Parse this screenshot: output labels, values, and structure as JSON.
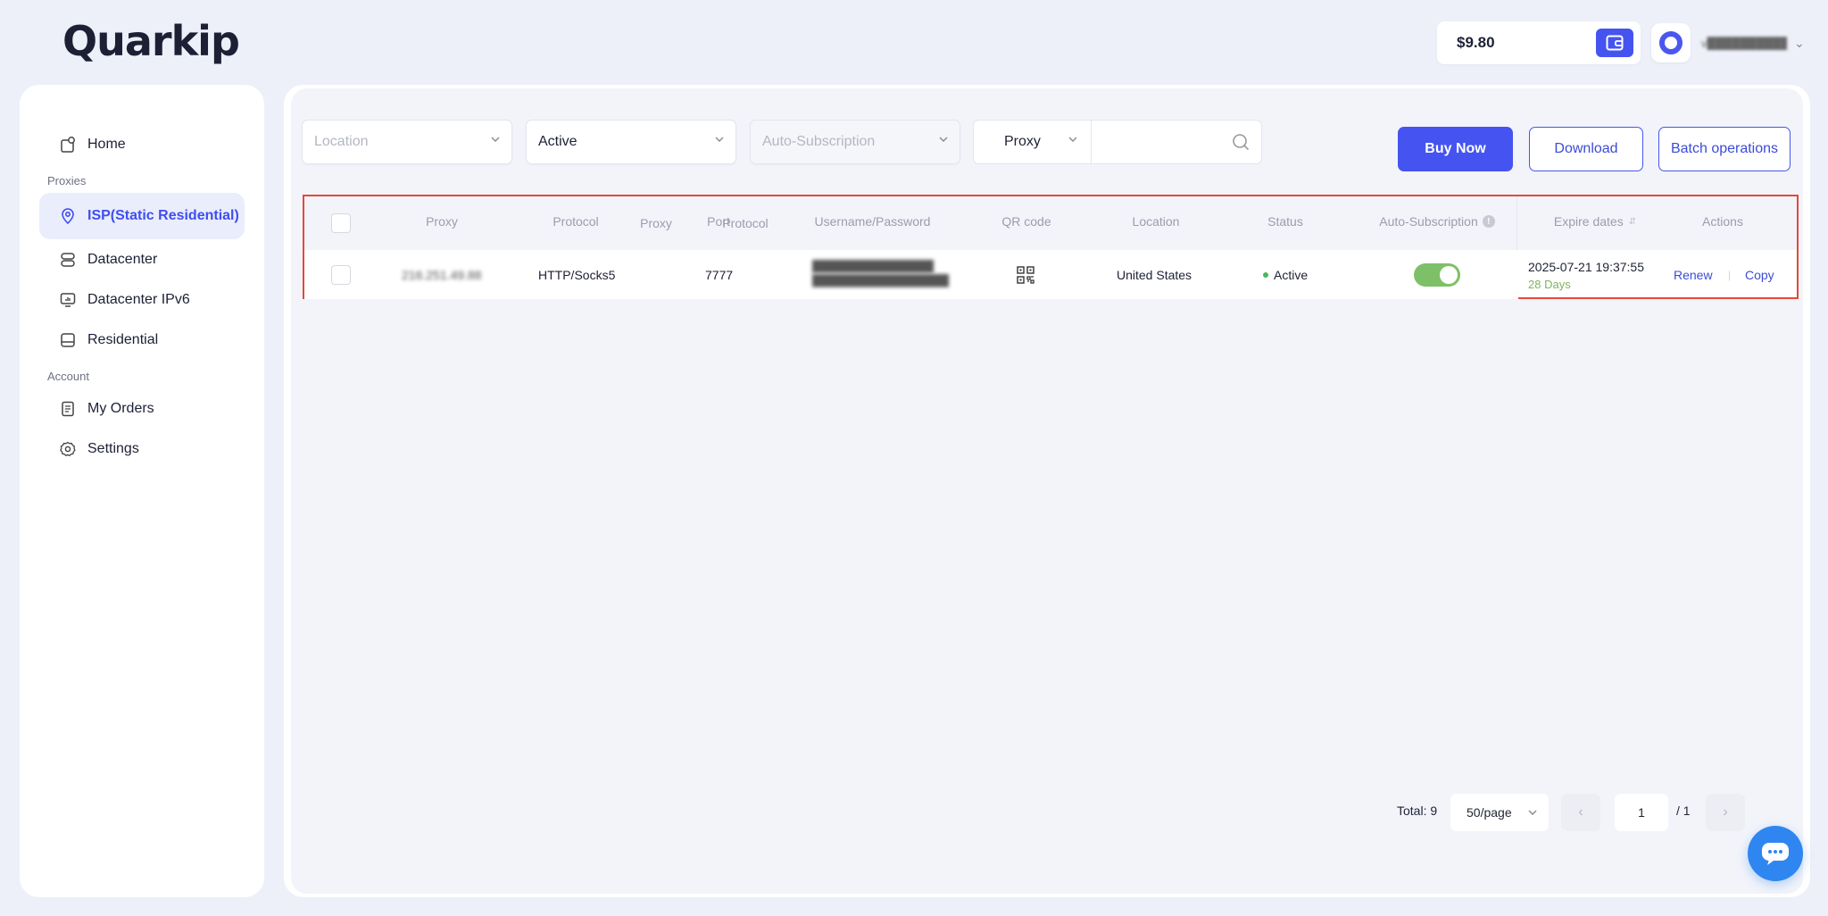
{
  "brand": {
    "logo_text": "Quarkip"
  },
  "header": {
    "balance": "$9.80",
    "username": "v████████████..."
  },
  "sidebar": {
    "items": [
      {
        "label": "Home",
        "icon": "home-icon"
      }
    ],
    "proxies_section": "Proxies",
    "proxies": [
      {
        "label": "ISP(Static Residential)",
        "icon": "location-pin-icon",
        "active": true
      },
      {
        "label": "Datacenter",
        "icon": "server-icon"
      },
      {
        "label": "Datacenter IPv6",
        "icon": "monitor-icon"
      },
      {
        "label": "Residential",
        "icon": "residential-icon"
      }
    ],
    "account_section": "Account",
    "account": [
      {
        "label": "My Orders",
        "icon": "orders-icon"
      },
      {
        "label": "Settings",
        "icon": "gear-icon"
      }
    ]
  },
  "filters": {
    "location_placeholder": "Location",
    "status_value": "Active",
    "auto_subscription_placeholder": "Auto-Subscription",
    "search_type": "Proxy",
    "search_value": ""
  },
  "actions": {
    "buy_now": "Buy Now",
    "download": "Download",
    "batch_operations": "Batch operations"
  },
  "table": {
    "columns": {
      "proxy": "Proxy",
      "protocol": "Protocol",
      "port": "Port",
      "username_password": "Username/Password",
      "qr_code": "QR code",
      "location": "Location",
      "status": "Status",
      "auto_subscription": "Auto-Subscription",
      "expire_dates": "Expire dates",
      "actions": "Actions"
    },
    "rows": [
      {
        "proxy": "216.251.49.88",
        "protocol": "HTTP/Socks5",
        "port": "7777",
        "username": "████████████████",
        "password": "██████████████████",
        "location": "United States",
        "status": "Active",
        "auto_subscription": true,
        "expire_date": "2025-07-21 19:37:55",
        "days_left": "28 Days",
        "renew": "Renew",
        "copy": "Copy"
      }
    ]
  },
  "pagination": {
    "total": "Total: 9",
    "page_size": "50/page",
    "current_page": "1",
    "of_pages": "/ 1"
  },
  "colors": {
    "accent": "#4554f0",
    "active_status": "#48b95b",
    "highlight_border": "#e5483b"
  }
}
